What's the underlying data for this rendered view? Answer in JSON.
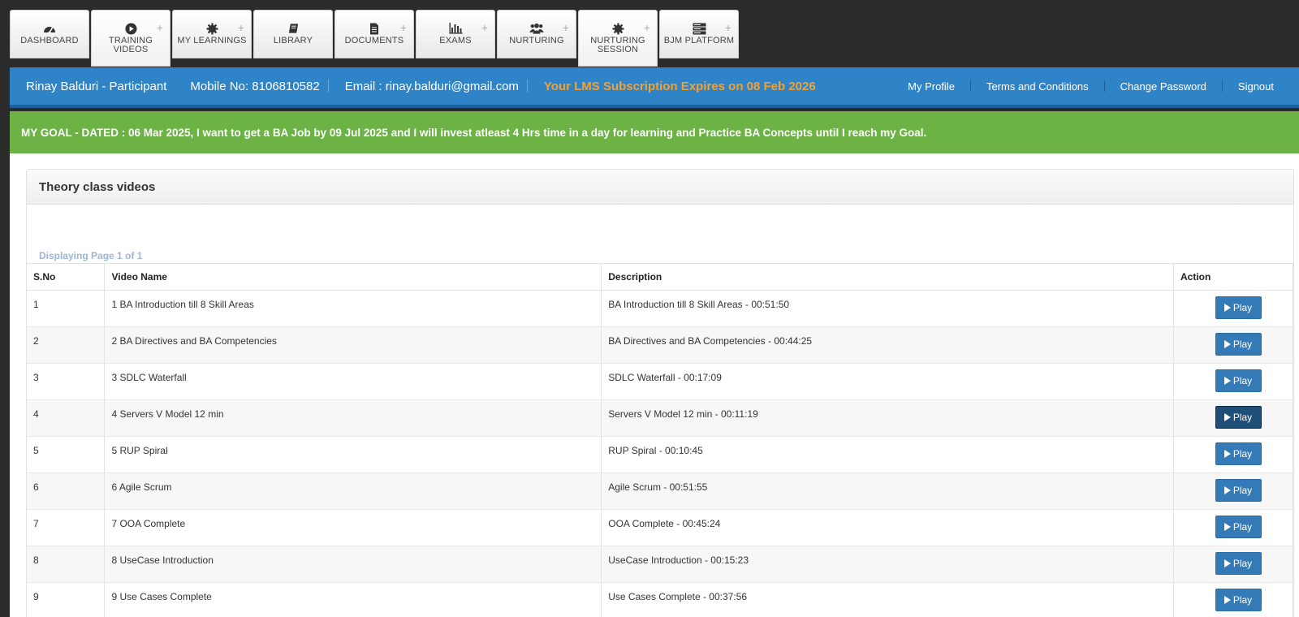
{
  "nav": {
    "tabs": [
      {
        "label": "DASHBOARD",
        "icon": "dashboard-icon",
        "plus": false,
        "active": false
      },
      {
        "label": "TRAINING VIDEOS",
        "icon": "play-circle-icon",
        "plus": true,
        "active": true
      },
      {
        "label": "MY LEARNINGS",
        "icon": "gear-icon",
        "plus": true,
        "active": false
      },
      {
        "label": "LIBRARY",
        "icon": "book-icon",
        "plus": false,
        "active": false
      },
      {
        "label": "DOCUMENTS",
        "icon": "document-icon",
        "plus": true,
        "active": false
      },
      {
        "label": "EXAMS",
        "icon": "bar-chart-icon",
        "plus": true,
        "active": false
      },
      {
        "label": "NURTURING",
        "icon": "users-icon",
        "plus": true,
        "active": false
      },
      {
        "label": "NURTURING SESSION",
        "icon": "gear-icon",
        "plus": true,
        "active": true
      },
      {
        "label": "BJM PLATFORM",
        "icon": "server-icon",
        "plus": true,
        "active": false
      }
    ],
    "plus_symbol": "+"
  },
  "infobar": {
    "participant": "Rinay Balduri - Participant",
    "mobile": "Mobile No: 8106810582",
    "email": "Email : rinay.balduri@gmail.com",
    "expiry": "Your LMS Subscription Expires on 08 Feb 2026",
    "links": [
      "My Profile",
      "Terms and Conditions",
      "Change Password",
      "Signout"
    ]
  },
  "goal": "MY GOAL - DATED : 06 Mar 2025, I want to get a BA Job by 09 Jul 2025 and I will invest atleast 4 Hrs time in a day for learning and Practice BA Concepts until I reach my Goal.",
  "panel": {
    "title": "Theory class videos",
    "page_info": "Displaying Page 1 of 1",
    "columns": [
      "S.No",
      "Video Name",
      "Description",
      "Action"
    ],
    "play_label": "Play",
    "rows": [
      {
        "sno": "1",
        "name": "1 BA Introduction till 8 Skill Areas",
        "desc": "BA Introduction till 8 Skill Areas - 00:51:50"
      },
      {
        "sno": "2",
        "name": "2 BA Directives and BA Competencies",
        "desc": "BA Directives and BA Competencies - 00:44:25"
      },
      {
        "sno": "3",
        "name": "3 SDLC Waterfall",
        "desc": "SDLC Waterfall - 00:17:09"
      },
      {
        "sno": "4",
        "name": "4 Servers V Model 12 min",
        "desc": "Servers V Model 12 min - 00:11:19"
      },
      {
        "sno": "5",
        "name": "5 RUP Spiral",
        "desc": "RUP Spiral - 00:10:45"
      },
      {
        "sno": "6",
        "name": "6 Agile Scrum",
        "desc": "Agile Scrum - 00:51:55"
      },
      {
        "sno": "7",
        "name": "7 OOA Complete",
        "desc": "OOA Complete - 00:45:24"
      },
      {
        "sno": "8",
        "name": "8 UseCase Introduction",
        "desc": "UseCase Introduction - 00:15:23"
      },
      {
        "sno": "9",
        "name": "9 Use Cases Complete",
        "desc": "Use Cases Complete - 00:37:56"
      }
    ]
  },
  "colors": {
    "infobar": "#2f84c8",
    "goalbar": "#6cb245",
    "expiry": "#f6a02f",
    "play": "#337ab7"
  }
}
